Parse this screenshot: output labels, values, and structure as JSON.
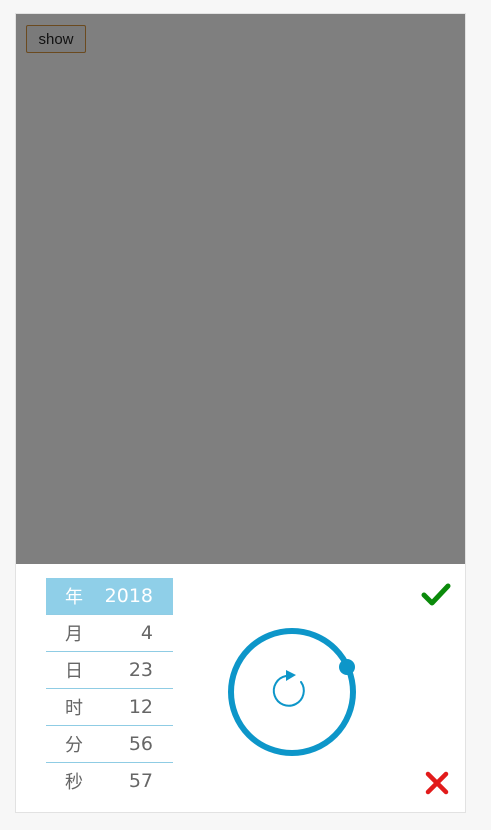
{
  "overlay": {
    "show_button": "show"
  },
  "picker": {
    "fields": [
      {
        "label": "年",
        "value": "2018",
        "active": true
      },
      {
        "label": "月",
        "value": "4"
      },
      {
        "label": "日",
        "value": "23"
      },
      {
        "label": "时",
        "value": "12"
      },
      {
        "label": "分",
        "value": "56"
      },
      {
        "label": "秒",
        "value": "57"
      }
    ],
    "icons": {
      "confirm": "check-icon",
      "cancel": "close-icon",
      "dial": "rotate-icon"
    }
  },
  "colors": {
    "overlay": "#7f7f7f",
    "accent": "#0d96c9",
    "active_row": "#8fcfe8",
    "confirm": "#0a8a0a",
    "cancel": "#e21b1b"
  }
}
